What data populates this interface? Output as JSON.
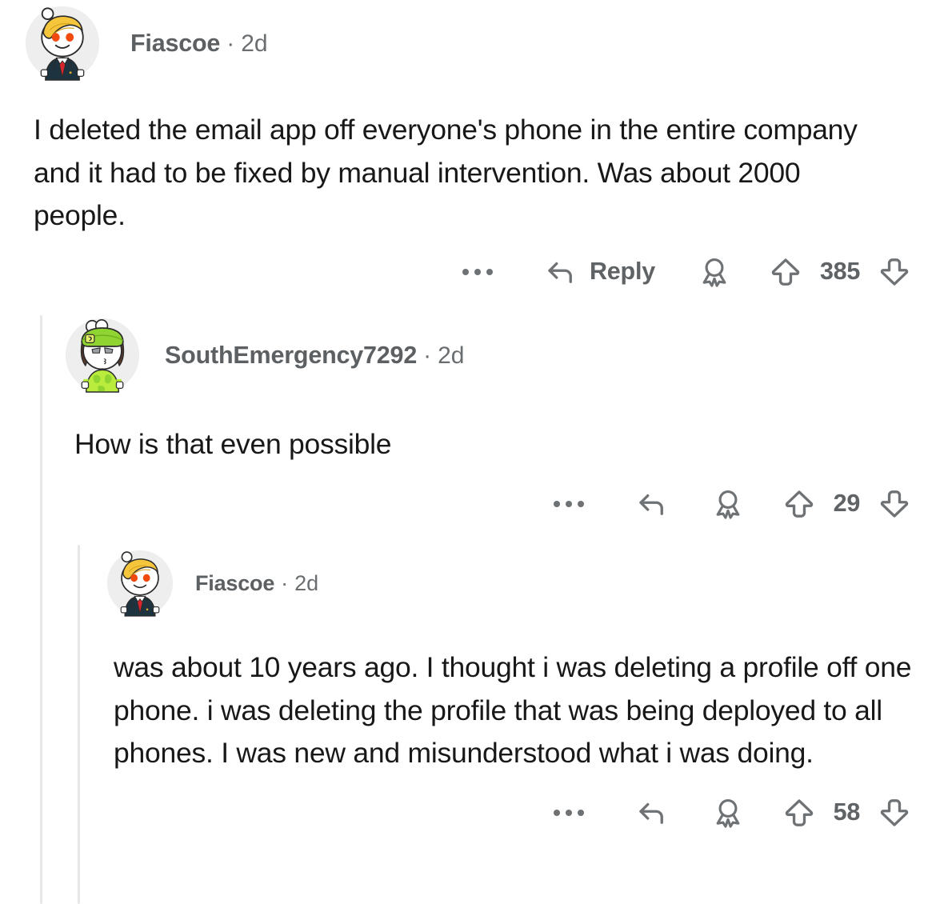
{
  "thread": {
    "comments": [
      {
        "id": "comment-0",
        "level": 0,
        "username": "Fiascoe",
        "separator": "·",
        "timestamp": "2d",
        "body": "I deleted the email app off everyone's phone in the entire company and it had to be fixed by manual intervention. Was about 2000 people.",
        "reply_label": "Reply",
        "show_reply_label": true,
        "vote_count": "385",
        "avatar": {
          "name": "snoo-avatar-suit",
          "hair_color": "#f5c63c",
          "body_color": "#ffffff",
          "suit_color": "#1d3440",
          "tie_color": "#d8262c",
          "eye_color": "#f2490c",
          "background": "#eeeeee"
        },
        "icons": {
          "overflow": "overflow-dots-icon",
          "reply": "reply-arrow-icon",
          "award": "award-medal-icon",
          "upvote": "upvote-arrow-icon",
          "downvote": "downvote-arrow-icon"
        }
      },
      {
        "id": "comment-1",
        "level": 1,
        "username": "SouthEmergency7292",
        "separator": "·",
        "timestamp": "2d",
        "body": "How is that even possible",
        "reply_label": "",
        "show_reply_label": false,
        "vote_count": "29",
        "avatar": {
          "name": "snoo-avatar-visor",
          "hair_color": "#5b3a28",
          "body_color": "#ffffff",
          "visor_color": "#8fd430",
          "shirt_color": "#b9ec3c",
          "eye_color": "#9aa0a4",
          "background": "#eeeeee"
        },
        "icons": {
          "overflow": "overflow-dots-icon",
          "reply": "reply-arrow-icon",
          "award": "award-medal-icon",
          "upvote": "upvote-arrow-icon",
          "downvote": "downvote-arrow-icon"
        }
      },
      {
        "id": "comment-2",
        "level": 2,
        "username": "Fiascoe",
        "separator": "·",
        "timestamp": "2d",
        "body": "was about 10 years ago. I thought i was deleting a profile off one phone. i was deleting the profile that was being deployed to all phones. I was new and misunderstood what i was doing.",
        "reply_label": "",
        "show_reply_label": false,
        "vote_count": "58",
        "avatar": {
          "name": "snoo-avatar-suit",
          "hair_color": "#f5c63c",
          "body_color": "#ffffff",
          "suit_color": "#1d3440",
          "tie_color": "#d8262c",
          "eye_color": "#f2490c",
          "background": "#eeeeee"
        },
        "icons": {
          "overflow": "overflow-dots-icon",
          "reply": "reply-arrow-icon",
          "award": "award-medal-icon",
          "upvote": "upvote-arrow-icon",
          "downvote": "downvote-arrow-icon"
        }
      }
    ],
    "colors": {
      "background": "#ffffff",
      "body_text": "#181818",
      "username_text": "#5c6063",
      "meta_text": "#6a6e70",
      "icon_stroke": "#6e7275",
      "thread_line": "#e6e7e8"
    }
  }
}
